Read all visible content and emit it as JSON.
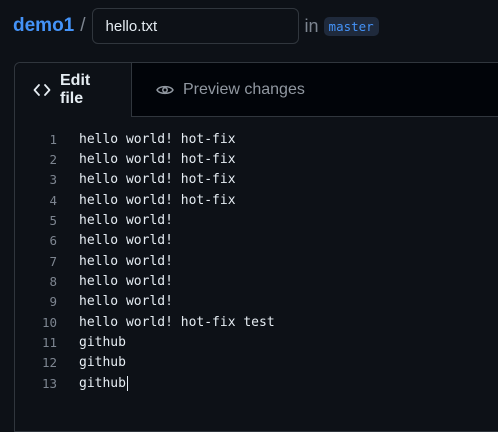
{
  "breadcrumb": {
    "repo": "demo1",
    "separator": "/",
    "filename": "hello.txt",
    "in_label": "in",
    "branch": "master"
  },
  "tabs": [
    {
      "label": "Edit file",
      "icon": "code-icon",
      "active": true
    },
    {
      "label": "Preview changes",
      "icon": "eye-icon",
      "active": false
    }
  ],
  "lines": [
    {
      "num": "1",
      "text": "hello world! hot-fix"
    },
    {
      "num": "2",
      "text": "hello world! hot-fix"
    },
    {
      "num": "3",
      "text": "hello world! hot-fix"
    },
    {
      "num": "4",
      "text": "hello world! hot-fix"
    },
    {
      "num": "5",
      "text": "hello world!"
    },
    {
      "num": "6",
      "text": "hello world!"
    },
    {
      "num": "7",
      "text": "hello world!"
    },
    {
      "num": "8",
      "text": "hello world!"
    },
    {
      "num": "9",
      "text": "hello world!"
    },
    {
      "num": "10",
      "text": "hello world! hot-fix test"
    },
    {
      "num": "11",
      "text": "github"
    },
    {
      "num": "12",
      "text": "github"
    },
    {
      "num": "13",
      "text": "github"
    }
  ],
  "colors": {
    "background": "#0d1117",
    "link": "#4493f8",
    "border": "#30363d",
    "muted": "#7d8590"
  }
}
